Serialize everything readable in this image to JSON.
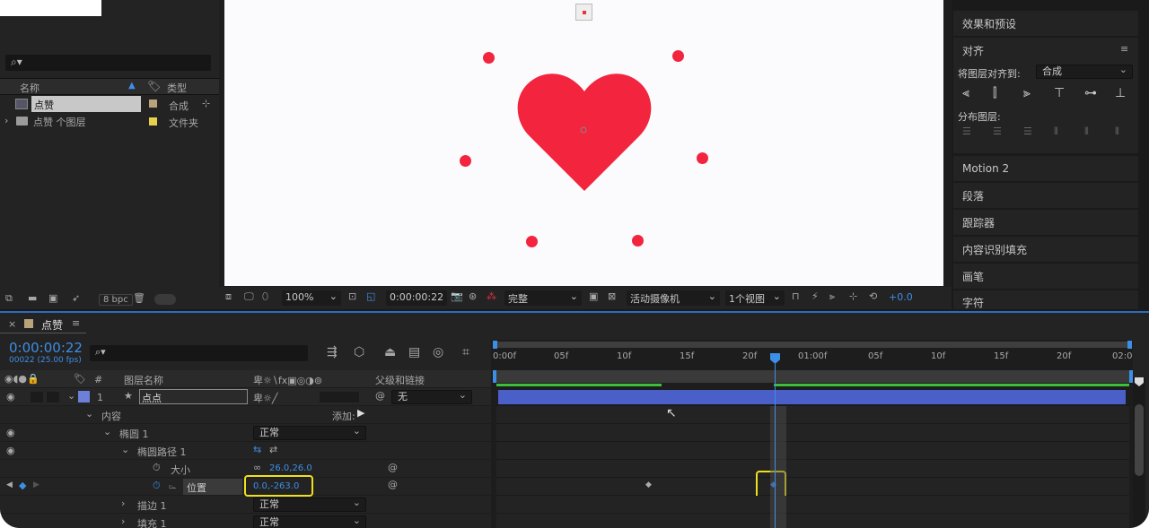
{
  "project": {
    "search_placeholder": "",
    "col_name": "名称",
    "col_type": "类型",
    "items": [
      {
        "name": "点赞",
        "type": "合成",
        "color": "#b9a37a"
      },
      {
        "name": "点赞 个图层",
        "type": "文件夹",
        "color": "#e7d04b"
      }
    ],
    "bpc": "8 bpc"
  },
  "viewer": {
    "zoom": "100%",
    "timecode": "0:00:00:22",
    "quality": "完整",
    "camera": "活动摄像机",
    "views": "1个视图",
    "exposure": "+0.0"
  },
  "right_panel": {
    "effects_presets": "效果和预设",
    "align_title": "对齐",
    "align_to_label": "将图层对齐到:",
    "align_to_value": "合成",
    "distribute_label": "分布图层:",
    "panels": [
      "Motion 2",
      "段落",
      "跟踪器",
      "内容识别填充",
      "画笔",
      "字符"
    ]
  },
  "timeline": {
    "comp_tab": "点赞",
    "timecode": "0:00:00:22",
    "frame_info": "00022 (25.00 fps)",
    "col_layer_name": "图层名称",
    "col_parent": "父级和链接",
    "layer": {
      "index": "1",
      "name": "点点",
      "parent": "无",
      "label_color": "#6c7fd9"
    },
    "contents": "内容",
    "add": "添加:",
    "ellipse_group": "椭圆 1",
    "ellipse_group_mode": "正常",
    "ellipse_path": "椭圆路径 1",
    "size_label": "大小",
    "size_value": "26.0,26.0",
    "position_label": "位置",
    "position_value": "0.0,-263.0",
    "stroke": "描边 1",
    "stroke_mode": "正常",
    "fill": "填充 1",
    "fill_mode": "正常",
    "ruler": [
      "0:00f",
      "05f",
      "10f",
      "15f",
      "20f",
      "01:00f",
      "05f",
      "10f",
      "15f",
      "20f",
      "02:0"
    ],
    "colors": {
      "accent": "#3d8ee6",
      "highlight": "#f0e01c",
      "heart": "#f2243e"
    }
  }
}
